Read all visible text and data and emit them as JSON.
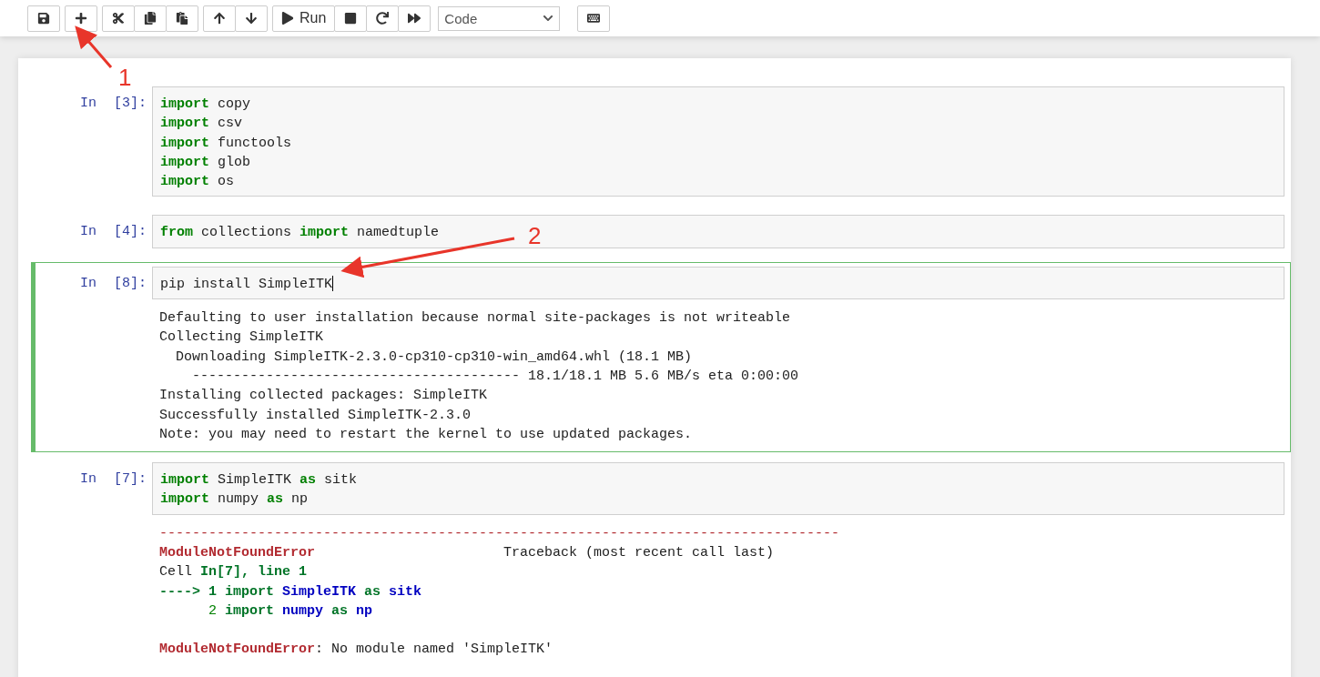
{
  "toolbar": {
    "run_label": "Run",
    "cell_type": "Code"
  },
  "cells": [
    {
      "prompt": "In [3]:",
      "selected": false,
      "input": [
        [
          {
            "kind": "keyword",
            "text": "import"
          },
          {
            "kind": "plain",
            "text": " copy"
          }
        ],
        [
          {
            "kind": "keyword",
            "text": "import"
          },
          {
            "kind": "plain",
            "text": " csv"
          }
        ],
        [
          {
            "kind": "keyword",
            "text": "import"
          },
          {
            "kind": "plain",
            "text": " functools"
          }
        ],
        [
          {
            "kind": "keyword",
            "text": "import"
          },
          {
            "kind": "plain",
            "text": " glob"
          }
        ],
        [
          {
            "kind": "keyword",
            "text": "import"
          },
          {
            "kind": "plain",
            "text": " os"
          }
        ]
      ]
    },
    {
      "prompt": "In [4]:",
      "selected": false,
      "input": [
        [
          {
            "kind": "keyword",
            "text": "from"
          },
          {
            "kind": "plain",
            "text": " collections "
          },
          {
            "kind": "keyword",
            "text": "import"
          },
          {
            "kind": "plain",
            "text": " namedtuple"
          }
        ]
      ]
    },
    {
      "prompt": "In [8]:",
      "selected": true,
      "input": [
        [
          {
            "kind": "plain",
            "text": "pip install SimpleITK"
          }
        ]
      ],
      "output": [
        [
          [
            {
              "kind": "plain",
              "text": "Defaulting to user installation because normal site-packages is not writeable"
            }
          ],
          [
            {
              "kind": "plain",
              "text": "Collecting SimpleITK"
            }
          ],
          [
            {
              "kind": "plain",
              "text": "  Downloading SimpleITK-2.3.0-cp310-cp310-win_amd64.whl (18.1 MB)"
            }
          ],
          [
            {
              "kind": "plain",
              "text": "    ---------------------------------------- 18.1/18.1 MB 5.6 MB/s eta 0:00:00"
            }
          ],
          [
            {
              "kind": "plain",
              "text": "Installing collected packages: SimpleITK"
            }
          ],
          [
            {
              "kind": "plain",
              "text": "Successfully installed SimpleITK-2.3.0"
            }
          ],
          [
            {
              "kind": "plain",
              "text": "Note: you may need to restart the kernel to use updated packages."
            }
          ]
        ]
      ]
    },
    {
      "prompt": "In [7]:",
      "selected": false,
      "input": [
        [
          {
            "kind": "keyword",
            "text": "import"
          },
          {
            "kind": "plain",
            "text": " SimpleITK "
          },
          {
            "kind": "keyword",
            "text": "as"
          },
          {
            "kind": "plain",
            "text": " sitk"
          }
        ],
        [
          {
            "kind": "keyword",
            "text": "import"
          },
          {
            "kind": "plain",
            "text": " numpy "
          },
          {
            "kind": "keyword",
            "text": "as"
          },
          {
            "kind": "plain",
            "text": " np"
          }
        ]
      ],
      "output": [
        [
          [
            {
              "kind": "error",
              "text": "-----------------------------------------------------------------------------------"
            }
          ],
          [
            {
              "kind": "error_bold",
              "text": "ModuleNotFoundError"
            },
            {
              "kind": "plain",
              "text": "                       Traceback (most recent call last)"
            }
          ],
          [
            {
              "kind": "plain",
              "text": "Cell "
            },
            {
              "kind": "green_bold",
              "text": "In[7], line 1"
            }
          ],
          [
            {
              "kind": "green_bold",
              "text": "----> 1 import"
            },
            {
              "kind": "blue_bold",
              "text": " SimpleITK"
            },
            {
              "kind": "green_bold",
              "text": " as"
            },
            {
              "kind": "blue_bold",
              "text": " sitk"
            }
          ],
          [
            {
              "kind": "green",
              "text": "      2 "
            },
            {
              "kind": "green_bold",
              "text": "import"
            },
            {
              "kind": "blue_bold",
              "text": " numpy"
            },
            {
              "kind": "green_bold",
              "text": " as"
            },
            {
              "kind": "blue_bold",
              "text": " np"
            }
          ]
        ],
        [
          [
            {
              "kind": "error_bold",
              "text": "ModuleNotFoundError"
            },
            {
              "kind": "plain",
              "text": ": No module named 'SimpleITK'"
            }
          ]
        ]
      ]
    }
  ],
  "annotations": [
    {
      "label": "1"
    },
    {
      "label": "2"
    }
  ]
}
